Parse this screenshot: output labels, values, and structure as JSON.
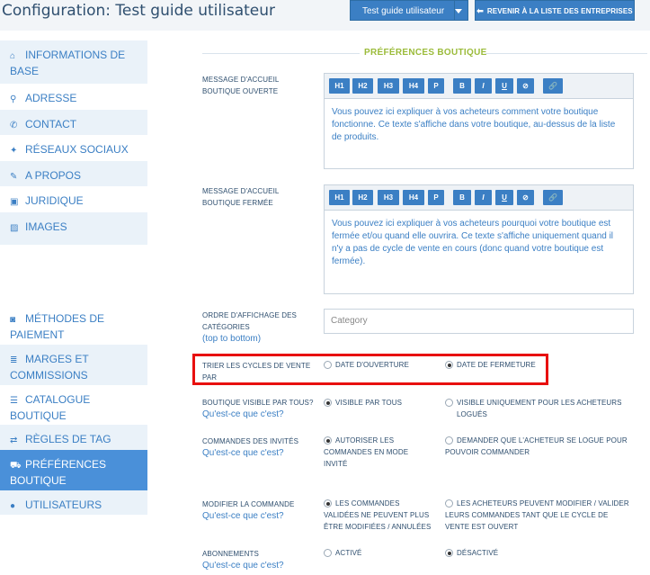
{
  "header": {
    "title": "Configuration: Test guide utilisateur",
    "dropdown_label": "Test guide utilisateur",
    "back_label": "REVENIR À LA LISTE DES ENTREPRISES"
  },
  "sidebar": {
    "items": [
      {
        "label": "INFORMATIONS DE BASE",
        "icon": "home-icon"
      },
      {
        "label": "ADRESSE",
        "icon": "map-marker-icon"
      },
      {
        "label": "CONTACT",
        "icon": "phone-icon"
      },
      {
        "label": "RÉSEAUX SOCIAUX",
        "icon": "twitter-icon"
      },
      {
        "label": "A PROPOS",
        "icon": "pencil-icon"
      },
      {
        "label": "JURIDIQUE",
        "icon": "briefcase-icon"
      },
      {
        "label": "IMAGES",
        "icon": "picture-icon"
      },
      {
        "label": "MÉTHODES DE PAIEMENT",
        "icon": "money-icon"
      },
      {
        "label": "MARGES ET COMMISSIONS",
        "icon": "stack-icon"
      },
      {
        "label": "CATALOGUE BOUTIQUE",
        "icon": "list-icon"
      },
      {
        "label": "RÈGLES DE TAG",
        "icon": "shuffle-icon"
      },
      {
        "label": "PRÉFÉRENCES BOUTIQUE",
        "icon": "cart-icon"
      },
      {
        "label": "UTILISATEURS",
        "icon": "user-icon"
      }
    ]
  },
  "main": {
    "section_title": "PRÉFÉRENCES BOUTIQUE",
    "toolbar_buttons": [
      "H1",
      "H2",
      "H3",
      "H4",
      "P",
      "B",
      "I",
      "U",
      "⊘",
      "🔗"
    ],
    "open_message": {
      "label": "MESSAGE D'ACCUEIL BOUTIQUE OUVERTE",
      "text": "Vous pouvez ici expliquer à vos acheteurs comment votre boutique fonctionne. Ce texte s'affiche dans votre boutique, au-dessus de la liste de produits."
    },
    "closed_message": {
      "label": "MESSAGE D'ACCUEIL BOUTIQUE FERMÉE",
      "text": "Vous pouvez ici expliquer à vos acheteurs pourquoi votre boutique est fermée et/ou quand elle ouvrira. Ce texte s'affiche uniquement quand il n'y a pas de cycle de vente en cours (donc quand votre boutique est fermée)."
    },
    "category_order": {
      "label": "ORDRE D'AFFICHAGE DES CATÉGORIES",
      "sublabel": "(top to bottom)",
      "placeholder": "Category"
    },
    "sort_cycles": {
      "label": "TRIER LES CYCLES DE VENTE PAR",
      "opt1": "DATE D'OUVERTURE",
      "opt2": "DATE DE FERMETURE",
      "selected": 2
    },
    "visible": {
      "label": "BOUTIQUE VISIBLE PAR TOUS?",
      "help": "Qu'est-ce que c'est?",
      "opt1": "VISIBLE PAR TOUS",
      "opt2": "VISIBLE UNIQUEMENT POUR LES ACHETEURS LOGUÉS",
      "selected": 1
    },
    "guest_orders": {
      "label": "COMMANDES DES INVITÉS",
      "help": "Qu'est-ce que c'est?",
      "opt1": "AUTORISER LES COMMANDES EN MODE INVITÉ",
      "opt2": "DEMANDER QUE L'ACHETEUR SE LOGUE POUR POUVOIR COMMANDER",
      "selected": 1
    },
    "modify_order": {
      "label": "MODIFIER LA COMMANDE",
      "help": "Qu'est-ce que c'est?",
      "opt1": "LES COMMANDES VALIDÉES NE PEUVENT PLUS ÊTRE MODIFIÉES / ANNULÉES",
      "opt2": "LES ACHETEURS PEUVENT MODIFIER / VALIDER LEURS COMMANDES TANT QUE LE CYCLE DE VENTE EST OUVERT",
      "selected": 1
    },
    "subscriptions": {
      "label": "ABONNEMENTS",
      "help": "Qu'est-ce que c'est?",
      "opt1": "ACTIVÉ",
      "opt2": "DÉSACTIVÉ",
      "selected": 2
    }
  }
}
